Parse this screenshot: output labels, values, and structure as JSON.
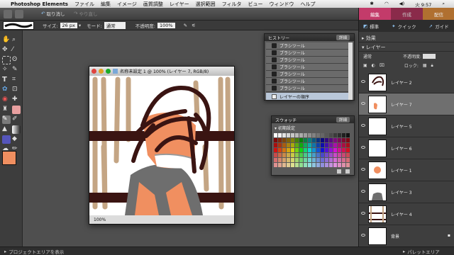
{
  "menubar": {
    "apple": "",
    "app": "Photoshop Elements",
    "items": [
      "ファイル",
      "編集",
      "イメージ",
      "画質調整",
      "レイヤー",
      "選択範囲",
      "フィルタ",
      "ビュー",
      "ウィンドウ",
      "ヘルプ"
    ],
    "clock": "火 9:57"
  },
  "topbar": {
    "undo": "取り消し",
    "redo": "やり直し"
  },
  "options": {
    "size_label": "サイズ:",
    "size_value": "26 px",
    "mode_label": "モード:",
    "mode_value": "通常",
    "opacity_label": "不透明度:",
    "opacity_value": "100%"
  },
  "document": {
    "title": "名称未設定 1 @ 100% (レイヤー 7, RGB/8)",
    "zoom": "100%"
  },
  "history": {
    "title": "ヒストリー",
    "more": "詳細",
    "items": [
      "ブラシツール",
      "ブラシツール",
      "ブラシツール",
      "ブラシツール",
      "ブラシツール",
      "ブラシツール",
      "ブラシツール"
    ],
    "last": "レイヤーの順序"
  },
  "swatches": {
    "title": "スウォッチ",
    "more": "詳細",
    "preset": "初期設定"
  },
  "right": {
    "tabs": [
      "編集",
      "作成",
      "配信"
    ],
    "subtabs": [
      "標準",
      "クイック",
      "ガイド"
    ],
    "effects": "効果",
    "layers_header": "レイヤー",
    "blend": "通常",
    "opacity_label": "不透明度:",
    "lock_label": "ロック:",
    "layers": [
      {
        "name": "レイヤー 2"
      },
      {
        "name": "レイヤー 7"
      },
      {
        "name": "レイヤー 5"
      },
      {
        "name": "レイヤー 6"
      },
      {
        "name": "レイヤー 1"
      },
      {
        "name": "レイヤー 3"
      },
      {
        "name": "レイヤー 4"
      },
      {
        "name": "背景"
      }
    ]
  },
  "status": {
    "left": "プロジェクトエリアを表示",
    "right": "パレットエリア"
  },
  "colors": {
    "foreground": "#f08f60",
    "edit_tab": "#c33b6a",
    "create_tab": "#a83355",
    "share_tab": "#d08a3a"
  }
}
